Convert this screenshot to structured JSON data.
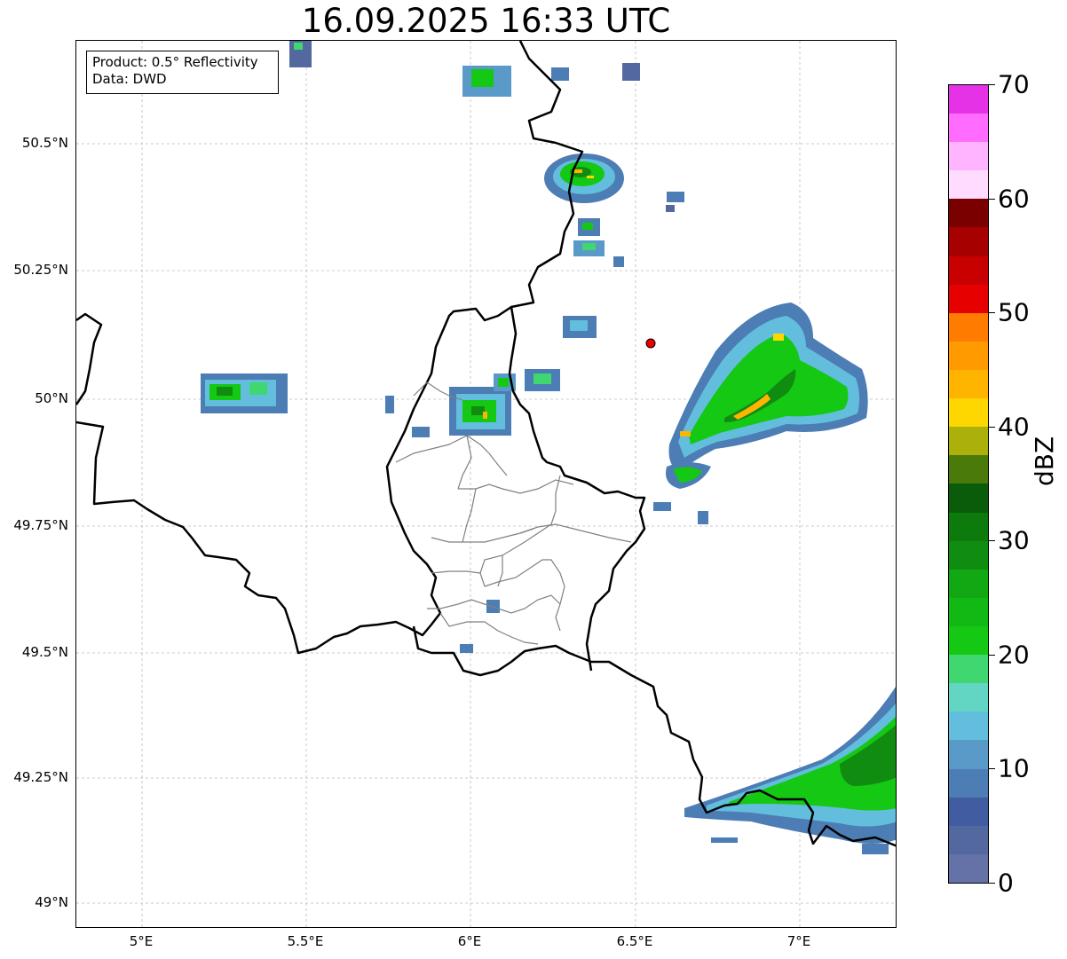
{
  "title": "16.09.2025 16:33 UTC",
  "info": {
    "product": "Product: 0.5° Reflectivity",
    "data": "Data: DWD"
  },
  "axes": {
    "lat_labels": [
      "50.5°N",
      "50.25°N",
      "50°N",
      "49.75°N",
      "49.5°N",
      "49.25°N",
      "49°N"
    ],
    "lon_labels": [
      "5°E",
      "5.5°E",
      "6°E",
      "6.5°E",
      "7°E"
    ]
  },
  "colorbar": {
    "label": "dBZ",
    "tick_labels": [
      "0",
      "10",
      "20",
      "30",
      "40",
      "50",
      "60",
      "70"
    ],
    "colors": [
      "#6472a8",
      "#5468a0",
      "#415ca0",
      "#4c7db4",
      "#5a9ac8",
      "#63bede",
      "#62d6c2",
      "#40d670",
      "#14c814",
      "#12b814",
      "#12a814",
      "#108c10",
      "#0c7a0c",
      "#0a5c0a",
      "#4a7a0a",
      "#acb00a",
      "#ffd700",
      "#ffb400",
      "#ff9a00",
      "#ff7c00",
      "#e60000",
      "#c80000",
      "#a60000",
      "#7a0000",
      "#ffdcff",
      "#ffb4ff",
      "#ff6cff",
      "#e632e6"
    ]
  },
  "legend": {
    "marker_color": "#ee0000"
  }
}
